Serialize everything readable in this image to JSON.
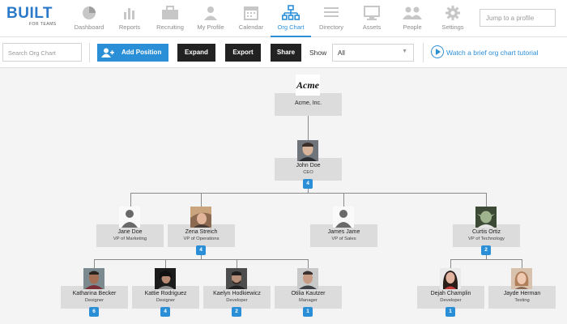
{
  "brand": {
    "name": "BUILT",
    "tagline": "FOR TEAMS"
  },
  "nav": [
    {
      "label": "Dashboard",
      "icon": "pie-chart-icon"
    },
    {
      "label": "Reports",
      "icon": "bar-chart-icon"
    },
    {
      "label": "Recruiting",
      "icon": "briefcase-icon"
    },
    {
      "label": "My Profile",
      "icon": "person-icon"
    },
    {
      "label": "Calendar",
      "icon": "calendar-icon"
    },
    {
      "label": "Org Chart",
      "icon": "org-chart-icon"
    },
    {
      "label": "Directory",
      "icon": "list-icon"
    },
    {
      "label": "Assets",
      "icon": "monitor-icon"
    },
    {
      "label": "People",
      "icon": "people-icon"
    },
    {
      "label": "Settings",
      "icon": "gear-icon"
    }
  ],
  "jump_placeholder": "Jump to a profile",
  "toolbar": {
    "search_placeholder": "Search Org Chart",
    "add_position": "Add Position",
    "expand": "Expand",
    "export": "Export",
    "share": "Share",
    "show_label": "Show",
    "show_value": "All",
    "tutorial": "Watch a brief org chart tutorial"
  },
  "org": {
    "company": {
      "name": "Acme, Inc.",
      "logo_text": "Acme"
    },
    "ceo": {
      "name": "John Doe",
      "title": "CEO",
      "reports": "4"
    },
    "vps": [
      {
        "name": "Jane Doe",
        "title": "VP of Marketing",
        "reports": ""
      },
      {
        "name": "Zena Streich",
        "title": "VP of Operations",
        "reports": "4"
      },
      {
        "name": "James Jame",
        "title": "VP of Sales",
        "reports": ""
      },
      {
        "name": "Curtis Ortiz",
        "title": "VP of Technology",
        "reports": "2"
      }
    ],
    "staff": [
      {
        "name": "Katharina Becker",
        "title": "Designer",
        "reports": "6"
      },
      {
        "name": "Kattie Rodriguez",
        "title": "Designer",
        "reports": "4"
      },
      {
        "name": "Kaelyn Hodkiewicz",
        "title": "Developer",
        "reports": "2"
      },
      {
        "name": "Otilia Kautzer",
        "title": "Manager",
        "reports": "1"
      },
      {
        "name": "Dejah Champlin",
        "title": "Developer",
        "reports": "1"
      },
      {
        "name": "Jayde Herman",
        "title": "Testing",
        "reports": ""
      }
    ]
  }
}
